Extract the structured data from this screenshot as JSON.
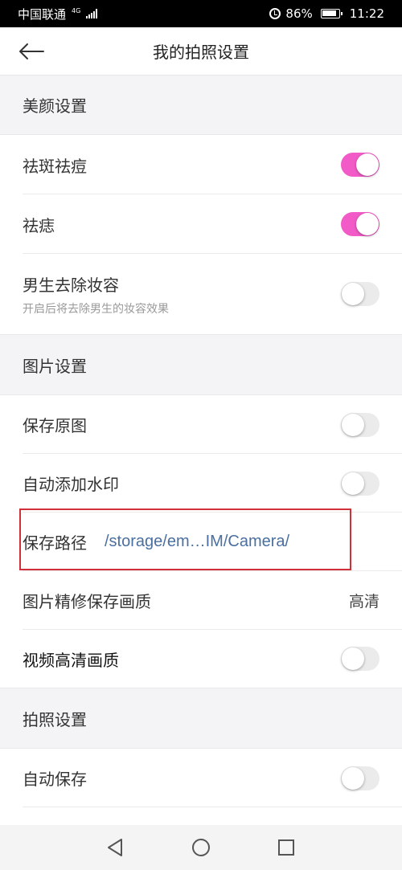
{
  "status_bar": {
    "carrier": "中国联通",
    "network": "4G",
    "battery": "86%",
    "time": "11:22"
  },
  "header": {
    "title": "我的拍照设置"
  },
  "sections": {
    "beauty": {
      "title": "美颜设置",
      "items": [
        {
          "label": "祛斑祛痘",
          "toggle": "on"
        },
        {
          "label": "祛痣",
          "toggle": "on"
        },
        {
          "label": "男生去除妆容",
          "sublabel": "开启后将去除男生的妆容效果",
          "toggle": "off"
        }
      ]
    },
    "picture": {
      "title": "图片设置",
      "items": [
        {
          "label": "保存原图",
          "toggle": "off"
        },
        {
          "label": "自动添加水印",
          "toggle": "off"
        },
        {
          "label": "保存路径",
          "value": "/storage/em…IM/Camera/"
        },
        {
          "label": "图片精修保存画质",
          "value": "高清"
        },
        {
          "label": "视频高清画质",
          "toggle": "off"
        }
      ]
    },
    "camera": {
      "title": "拍照设置",
      "items": [
        {
          "label": "自动保存",
          "toggle": "off"
        }
      ]
    }
  },
  "colors": {
    "toggle_on": "#f25bc7",
    "toggle_off": "#ebebeb",
    "highlight": "#d0303a",
    "path_text": "#4a6fa0"
  }
}
